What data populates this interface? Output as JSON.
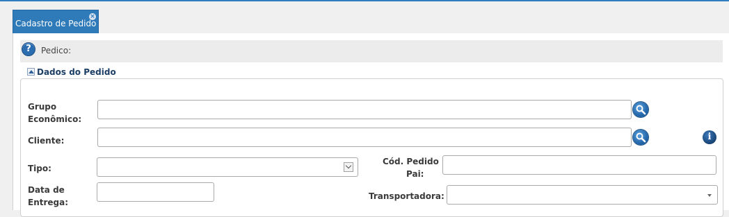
{
  "tabs": [
    {
      "label": "Cadastro de Pedido",
      "close_icon": "close-icon"
    }
  ],
  "infobar": {
    "icon": "help-icon",
    "label": "Pedico:"
  },
  "section": {
    "title": "Dados do Pedido",
    "toggle_icon": "collapse-up-icon"
  },
  "form": {
    "grupo_economico": {
      "label_line1": "Grupo",
      "label_line2": "Econômico:",
      "value": ""
    },
    "cliente": {
      "label": "Cliente:",
      "value": ""
    },
    "tipo": {
      "label": "Tipo:",
      "selected": ""
    },
    "cod_pedido_pai": {
      "label_line1": "Cód. Pedido",
      "label_line2": "Pai:",
      "value": ""
    },
    "data_entrega": {
      "label_line1": "Data de",
      "label_line2": "Entrega:",
      "value": ""
    },
    "transportadora": {
      "label": "Transportadora:",
      "selected": ""
    }
  },
  "colors": {
    "accent": "#2f7ab9",
    "section_title": "#1d3f66"
  }
}
